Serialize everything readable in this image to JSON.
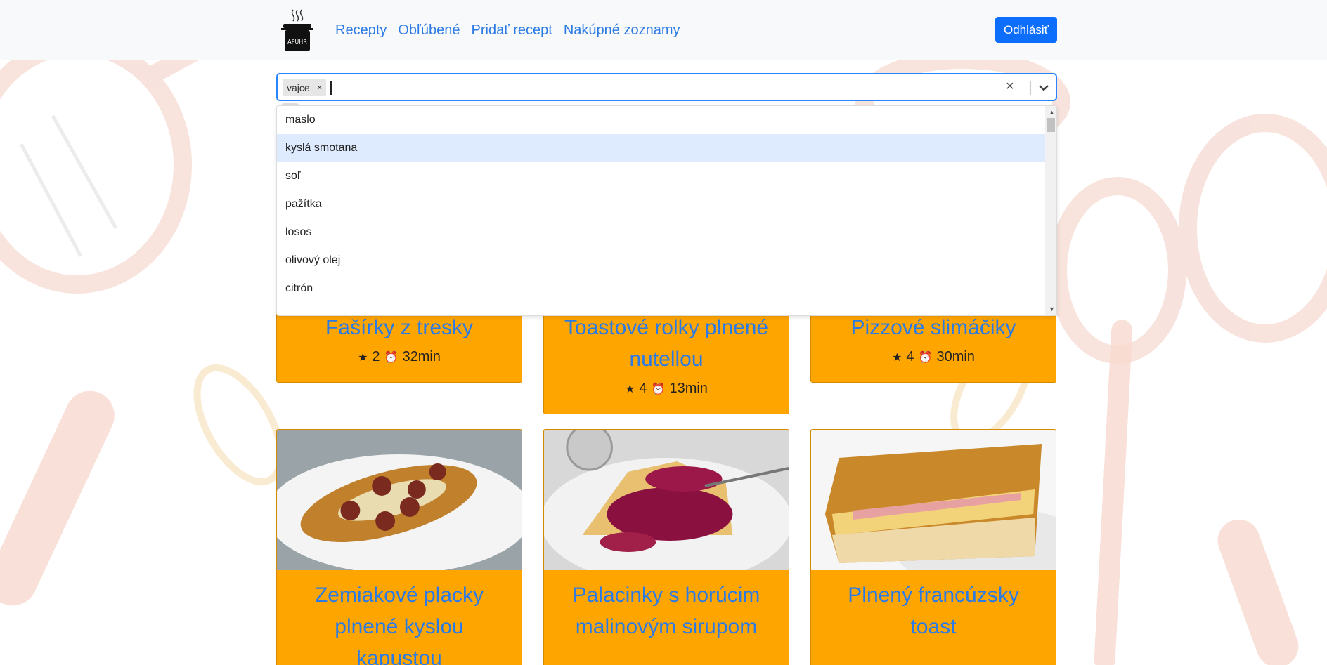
{
  "nav": {
    "logo_text": "APUHR",
    "links": [
      "Recepty",
      "Obľúbené",
      "Pridať recept",
      "Nakúpné zoznamy"
    ],
    "logout_label": "Odhlásiť"
  },
  "search": {
    "selected_tags": [
      "vajce"
    ],
    "clear_symbol": "×",
    "options": [
      "maslo",
      "kyslá smotana",
      "soľ",
      "pažítka",
      "losos",
      "olivový olej",
      "citrón"
    ],
    "highlighted_option": "kyslá smotana"
  },
  "cards_row1": [
    {
      "title": "Fašírky z tresky",
      "rating": "2",
      "time": "32min"
    },
    {
      "title": "Toastové rolky plnené nutellou",
      "rating": "4",
      "time": "13min"
    },
    {
      "title": "Pizzové slimáčiky",
      "rating": "4",
      "time": "30min"
    }
  ],
  "cards_row2": [
    {
      "title": "Zemiakové placky plnené kyslou kapustou",
      "image": "fried-potato-pancake-with-sausage"
    },
    {
      "title": "Palacinky s horúcim malinovým sirupom",
      "image": "crepes-with-raspberry-syrup"
    },
    {
      "title": "Plnený francúzsky toast",
      "image": "stuffed-french-toast"
    }
  ],
  "colors": {
    "card_bg": "#ffa500",
    "link": "#2c7be5",
    "primary_button": "#0d6efd",
    "focus_border": "#2684ff",
    "highlight": "#deebff"
  }
}
